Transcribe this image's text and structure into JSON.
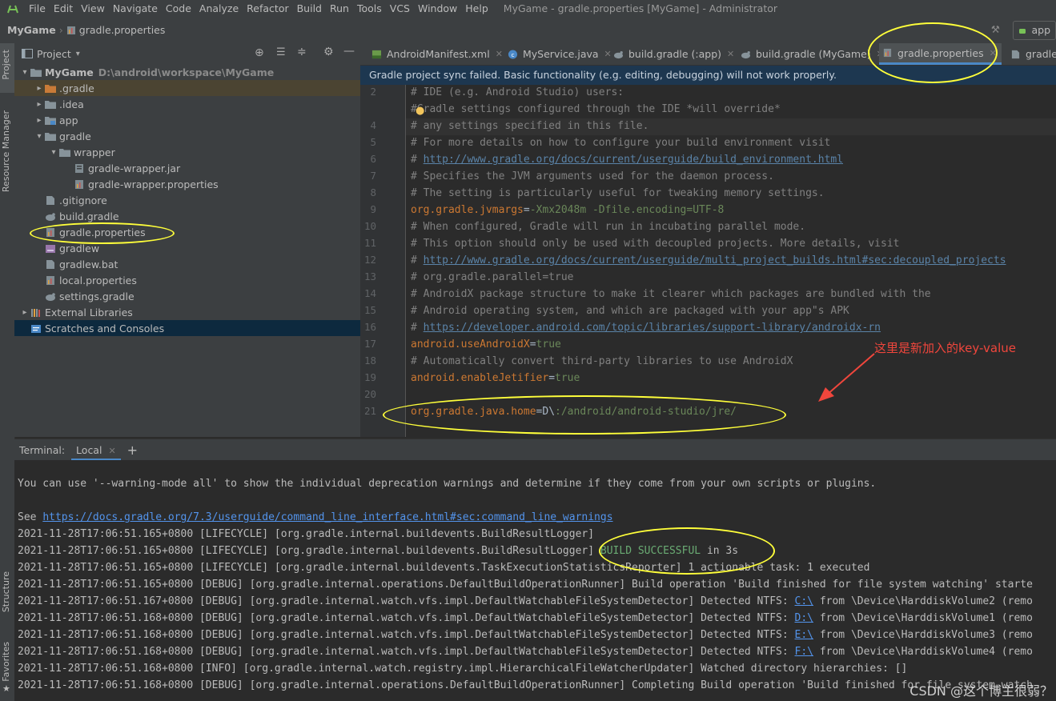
{
  "menubar": {
    "items": [
      "File",
      "Edit",
      "View",
      "Navigate",
      "Code",
      "Analyze",
      "Refactor",
      "Build",
      "Run",
      "Tools",
      "VCS",
      "Window",
      "Help"
    ],
    "window_title": "MyGame - gradle.properties [MyGame] - Administrator"
  },
  "navbar": {
    "project": "MyGame",
    "file": "gradle.properties",
    "run_config": "app"
  },
  "leftstrip": {
    "project": "Project",
    "resource_manager": "Resource Manager",
    "structure": "Structure",
    "favorites": "Favorites"
  },
  "project_panel": {
    "title": "Project",
    "tree": [
      {
        "label": "MyGame",
        "path": "D:\\android\\workspace\\MyGame",
        "indent": 0,
        "arrow": "▾",
        "icon": "folder"
      },
      {
        "label": ".gradle",
        "indent": 1,
        "arrow": "▸",
        "icon": "folder-orange"
      },
      {
        "label": ".idea",
        "indent": 1,
        "arrow": "▸",
        "icon": "folder"
      },
      {
        "label": "app",
        "indent": 1,
        "arrow": "▸",
        "icon": "folder-module"
      },
      {
        "label": "gradle",
        "indent": 1,
        "arrow": "▾",
        "icon": "folder"
      },
      {
        "label": "wrapper",
        "indent": 2,
        "arrow": "▾",
        "icon": "folder"
      },
      {
        "label": "gradle-wrapper.jar",
        "indent": 3,
        "arrow": "",
        "icon": "jar"
      },
      {
        "label": "gradle-wrapper.properties",
        "indent": 3,
        "arrow": "",
        "icon": "props"
      },
      {
        "label": ".gitignore",
        "indent": 1,
        "arrow": "",
        "icon": "file"
      },
      {
        "label": "build.gradle",
        "indent": 1,
        "arrow": "",
        "icon": "gradle"
      },
      {
        "label": "gradle.properties",
        "indent": 1,
        "arrow": "",
        "icon": "props"
      },
      {
        "label": "gradlew",
        "indent": 1,
        "arrow": "",
        "icon": "exec"
      },
      {
        "label": "gradlew.bat",
        "indent": 1,
        "arrow": "",
        "icon": "file"
      },
      {
        "label": "local.properties",
        "indent": 1,
        "arrow": "",
        "icon": "props"
      },
      {
        "label": "settings.gradle",
        "indent": 1,
        "arrow": "",
        "icon": "gradle"
      },
      {
        "label": "External Libraries",
        "indent": 0,
        "arrow": "▸",
        "icon": "libs"
      },
      {
        "label": "Scratches and Consoles",
        "indent": 0,
        "arrow": "",
        "icon": "scratch"
      }
    ]
  },
  "tabs": [
    {
      "label": "AndroidManifest.xml",
      "icon": "xml"
    },
    {
      "label": "MyService.java",
      "icon": "class"
    },
    {
      "label": "build.gradle (:app)",
      "icon": "gradle"
    },
    {
      "label": "build.gradle (MyGame)",
      "icon": "gradle"
    },
    {
      "label": "gradle.properties",
      "icon": "props",
      "active": true
    },
    {
      "label": "gradlew",
      "icon": "file"
    }
  ],
  "banner": "Gradle project sync failed. Basic functionality (e.g. editing, debugging) will not work properly.",
  "editor": {
    "lines": [
      {
        "n": "2",
        "segs": [
          {
            "c": "com",
            "t": "# IDE (e.g. Android Studio) users:"
          }
        ]
      },
      {
        "n": "",
        "segs": [
          {
            "c": "com",
            "t": "#Gradle settings configured through the IDE *will override*"
          }
        ]
      },
      {
        "n": "4",
        "segs": [
          {
            "c": "com",
            "t": "# any settings specified in this file."
          }
        ]
      },
      {
        "n": "5",
        "segs": [
          {
            "c": "com",
            "t": "# For more details on how to configure your build environment visit"
          }
        ]
      },
      {
        "n": "6",
        "segs": [
          {
            "c": "com",
            "t": "# "
          },
          {
            "c": "url",
            "t": "http://www.gradle.org/docs/current/userguide/build_environment.html"
          }
        ]
      },
      {
        "n": "7",
        "segs": [
          {
            "c": "com",
            "t": "# Specifies the JVM arguments used for the daemon process."
          }
        ]
      },
      {
        "n": "8",
        "segs": [
          {
            "c": "com",
            "t": "# The setting is particularly useful for tweaking memory settings."
          }
        ]
      },
      {
        "n": "9",
        "segs": [
          {
            "c": "key",
            "t": "org.gradle.jvmargs"
          },
          {
            "c": "eq",
            "t": "="
          },
          {
            "c": "val",
            "t": "-Xmx2048m -Dfile.encoding=UTF-8"
          }
        ]
      },
      {
        "n": "10",
        "segs": [
          {
            "c": "com",
            "t": "# When configured, Gradle will run in incubating parallel mode."
          }
        ]
      },
      {
        "n": "11",
        "segs": [
          {
            "c": "com",
            "t": "# This option should only be used with decoupled projects. More details, visit"
          }
        ]
      },
      {
        "n": "12",
        "segs": [
          {
            "c": "com",
            "t": "# "
          },
          {
            "c": "url",
            "t": "http://www.gradle.org/docs/current/userguide/multi_project_builds.html#sec:decoupled_projects"
          }
        ]
      },
      {
        "n": "13",
        "segs": [
          {
            "c": "com",
            "t": "# org.gradle.parallel=true"
          }
        ]
      },
      {
        "n": "14",
        "segs": [
          {
            "c": "com",
            "t": "# AndroidX package structure to make it clearer which packages are bundled with the"
          }
        ]
      },
      {
        "n": "15",
        "segs": [
          {
            "c": "com",
            "t": "# Android operating system, and which are packaged with your app\"s APK"
          }
        ]
      },
      {
        "n": "16",
        "segs": [
          {
            "c": "com",
            "t": "# "
          },
          {
            "c": "url",
            "t": "https://developer.android.com/topic/libraries/support-library/androidx-rn"
          }
        ]
      },
      {
        "n": "17",
        "segs": [
          {
            "c": "key",
            "t": "android.useAndroidX"
          },
          {
            "c": "eq",
            "t": "="
          },
          {
            "c": "val",
            "t": "true"
          }
        ]
      },
      {
        "n": "18",
        "segs": [
          {
            "c": "com",
            "t": "# Automatically convert third-party libraries to use AndroidX"
          }
        ]
      },
      {
        "n": "19",
        "segs": [
          {
            "c": "key",
            "t": "android.enableJetifier"
          },
          {
            "c": "eq",
            "t": "="
          },
          {
            "c": "val",
            "t": "true"
          }
        ]
      },
      {
        "n": "20",
        "segs": []
      },
      {
        "n": "21",
        "segs": [
          {
            "c": "key",
            "t": "org.gradle.java.home"
          },
          {
            "c": "eq",
            "t": "="
          },
          {
            "c": "eq",
            "t": "D\\"
          },
          {
            "c": "val",
            "t": ":/android/android-studio/jre/"
          }
        ]
      }
    ]
  },
  "annotation": "这里是新加入的key-value",
  "terminal": {
    "title": "Terminal:",
    "tab": "Local",
    "lines": [
      {
        "segs": []
      },
      {
        "segs": [
          {
            "c": "",
            "t": "You can use '--warning-mode all' to show the individual deprecation warnings and determine if they come from your own scripts or plugins."
          }
        ]
      },
      {
        "segs": []
      },
      {
        "segs": [
          {
            "c": "",
            "t": "See "
          },
          {
            "c": "link",
            "t": "https://docs.gradle.org/7.3/userguide/command_line_interface.html#sec:command_line_warnings"
          }
        ]
      },
      {
        "segs": [
          {
            "c": "",
            "t": "2021-11-28T17:06:51.165+0800 [LIFECYCLE] [org.gradle.internal.buildevents.BuildResultLogger]"
          }
        ]
      },
      {
        "segs": [
          {
            "c": "",
            "t": "2021-11-28T17:06:51.165+0800 [LIFECYCLE] [org.gradle.internal.buildevents.BuildResultLogger] "
          },
          {
            "c": "ok",
            "t": "BUILD SUCCESSFUL"
          },
          {
            "c": "",
            "t": " in 3s"
          }
        ]
      },
      {
        "segs": [
          {
            "c": "",
            "t": "2021-11-28T17:06:51.165+0800 [LIFECYCLE] [org.gradle.internal.buildevents.TaskExecutionStatisticsReporter] 1 actionable task: 1 executed"
          }
        ]
      },
      {
        "segs": [
          {
            "c": "",
            "t": "2021-11-28T17:06:51.165+0800 [DEBUG] [org.gradle.internal.operations.DefaultBuildOperationRunner] Build operation 'Build finished for file system watching' starte"
          }
        ]
      },
      {
        "segs": [
          {
            "c": "",
            "t": "2021-11-28T17:06:51.167+0800 [DEBUG] [org.gradle.internal.watch.vfs.impl.DefaultWatchableFileSystemDetector] Detected NTFS: "
          },
          {
            "c": "link",
            "t": "C:\\"
          },
          {
            "c": "",
            "t": " from \\Device\\HarddiskVolume2 (remo"
          }
        ]
      },
      {
        "segs": [
          {
            "c": "",
            "t": "2021-11-28T17:06:51.168+0800 [DEBUG] [org.gradle.internal.watch.vfs.impl.DefaultWatchableFileSystemDetector] Detected NTFS: "
          },
          {
            "c": "link",
            "t": "D:\\"
          },
          {
            "c": "",
            "t": " from \\Device\\HarddiskVolume1 (remo"
          }
        ]
      },
      {
        "segs": [
          {
            "c": "",
            "t": "2021-11-28T17:06:51.168+0800 [DEBUG] [org.gradle.internal.watch.vfs.impl.DefaultWatchableFileSystemDetector] Detected NTFS: "
          },
          {
            "c": "link",
            "t": "E:\\"
          },
          {
            "c": "",
            "t": " from \\Device\\HarddiskVolume3 (remo"
          }
        ]
      },
      {
        "segs": [
          {
            "c": "",
            "t": "2021-11-28T17:06:51.168+0800 [DEBUG] [org.gradle.internal.watch.vfs.impl.DefaultWatchableFileSystemDetector] Detected NTFS: "
          },
          {
            "c": "link",
            "t": "F:\\"
          },
          {
            "c": "",
            "t": " from \\Device\\HarddiskVolume4 (remo"
          }
        ]
      },
      {
        "segs": [
          {
            "c": "",
            "t": "2021-11-28T17:06:51.168+0800 [INFO] [org.gradle.internal.watch.registry.impl.HierarchicalFileWatcherUpdater] Watched directory hierarchies: []"
          }
        ]
      },
      {
        "segs": [
          {
            "c": "",
            "t": "2021-11-28T17:06:51.168+0800 [DEBUG] [org.gradle.internal.operations.DefaultBuildOperationRunner] Completing Build operation 'Build finished for file system watch"
          }
        ]
      }
    ]
  },
  "watermark": "CSDN @这个博主很弱？",
  "colors": {
    "accent": "#4a88c7",
    "highlight_ellipse": "#ffff3a",
    "annotation": "#f0463c",
    "success": "#6aab73"
  }
}
